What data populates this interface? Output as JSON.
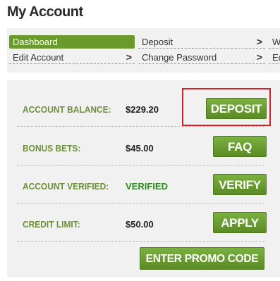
{
  "page": {
    "title": "My Account"
  },
  "nav": {
    "row1": [
      {
        "label": "Dashboard",
        "active": true
      },
      {
        "label": "Deposit",
        "chevron": ">"
      },
      {
        "label": "W"
      }
    ],
    "row2": [
      {
        "label": "Edit Account",
        "chevron": ">"
      },
      {
        "label": "Change Password",
        "chevron": ">"
      },
      {
        "label": "Ec"
      }
    ]
  },
  "account": {
    "rows": [
      {
        "label": "ACCOUNT BALANCE:",
        "value": "$229.20",
        "button": "DEPOSIT"
      },
      {
        "label": "BONUS BETS:",
        "value": "$45.00",
        "button": "FAQ"
      },
      {
        "label": "ACCOUNT VERIFIED:",
        "value": "VERIFIED",
        "button": "VERIFY"
      },
      {
        "label": "CREDIT LIMIT:",
        "value": "$50.00",
        "button": "APPLY"
      }
    ],
    "promo_button": "ENTER PROMO CODE"
  },
  "colors": {
    "accent_green": "#6a9a2c",
    "label_green": "#6e8f3a",
    "verified_green": "#2f8a1e",
    "highlight_red": "#d81f26"
  }
}
